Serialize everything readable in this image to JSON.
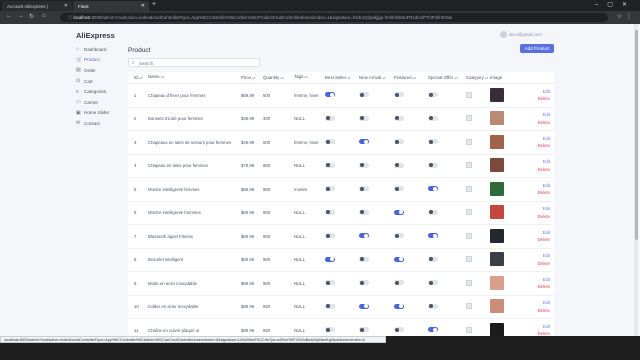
{
  "browser": {
    "tabs": [
      {
        "title": "Account AliExpress |"
      },
      {
        "title": "Flask"
      }
    ],
    "address_host": "localhost",
    "address_rest": ":8000/admin?crudAction=index&crudControllerFqcn=App%5CController%5CAdmin%5CProductCrudController&menuIndex=1&signature=h1dc1Qzpwljjgp-Xmhhhi5SuFR1dm1P7fJPmfn03nw",
    "status_url": "localhost:8000/admin?crudAction=index&crudControllerFqcn=App%5CController%5CAdmin%5CCarrCrudController&menuIndex=6&signature=U2hUMeeTKCCrfn7pw-wIEIsh%2FJGWxBudAXykfwvEgl4sub&menuIndex=6"
  },
  "app": {
    "brand": "AliExpress",
    "user_email": "alice@gmail.com",
    "page_title": "Product",
    "add_button": "Add Product",
    "search_placeholder": "Search"
  },
  "sidebar": {
    "items": [
      {
        "label": "Dashboard",
        "icon": "home-icon",
        "glyph": "⌂",
        "active": false
      },
      {
        "label": "Product",
        "icon": "shopping-cart-icon",
        "glyph": "🛒",
        "active": true
      },
      {
        "label": "Order",
        "icon": "receipt-icon",
        "glyph": "▤",
        "active": false
      },
      {
        "label": "Cart",
        "icon": "cart-icon",
        "glyph": "⊡",
        "active": false
      },
      {
        "label": "Categories",
        "icon": "list-icon",
        "glyph": "≡",
        "active": false
      },
      {
        "label": "Carrier",
        "icon": "truck-icon",
        "glyph": "▭",
        "active": false
      },
      {
        "label": "Home Slider",
        "icon": "image-icon",
        "glyph": "▣",
        "active": false
      },
      {
        "label": "Contact",
        "icon": "envelope-icon",
        "glyph": "✉",
        "active": false
      }
    ]
  },
  "table": {
    "columns": {
      "id": "ID",
      "name": "Name",
      "price": "Price",
      "quantity": "Quantity",
      "tags": "Tags",
      "best_seller": "Best Seller",
      "new_arrival": "New Arrival",
      "featured": "Featured",
      "special_offer": "Special Offer",
      "category": "Category",
      "image": "Image"
    },
    "edit_label": "Edit",
    "delete_label": "Delete",
    "rows": [
      {
        "id": "1",
        "name": "Chapeau d'hiver pour femmes",
        "price": "$69.99",
        "qty": "500",
        "tags": "femme, hiver",
        "best": true,
        "new": false,
        "feat": false,
        "spec": false,
        "img": "#3a2c3a"
      },
      {
        "id": "2",
        "name": "Bonnets tricoté pour femmes",
        "price": "$39.99",
        "qty": "300",
        "tags": "NULL",
        "best": false,
        "new": false,
        "feat": false,
        "spec": false,
        "img": "#b98b73"
      },
      {
        "id": "3",
        "name": "Chapeaux en laine de velours pour femmes",
        "price": "$49.99",
        "qty": "500",
        "tags": "femme, hiver",
        "best": false,
        "new": true,
        "feat": false,
        "spec": false,
        "img": "#a0624a"
      },
      {
        "id": "4",
        "name": "Chapeau en laine pour femmes",
        "price": "$79.99",
        "qty": "800",
        "tags": "NULL",
        "best": false,
        "new": false,
        "feat": false,
        "spec": false,
        "img": "#7a4a3c"
      },
      {
        "id": "5",
        "name": "Montre intelligente femmes",
        "price": "$89.99",
        "qty": "900",
        "tags": "montre",
        "best": false,
        "new": false,
        "feat": false,
        "spec": true,
        "img": "#2f6b3a"
      },
      {
        "id": "6",
        "name": "Montre intelligente hommes",
        "price": "$69.99",
        "qty": "800",
        "tags": "NULL",
        "best": false,
        "new": false,
        "feat": true,
        "spec": false,
        "img": "#c4473f"
      },
      {
        "id": "7",
        "name": "Bluetooth appel Fitness",
        "price": "$69.99",
        "qty": "800",
        "tags": "NULL",
        "best": false,
        "new": true,
        "feat": false,
        "spec": true,
        "img": "#222831"
      },
      {
        "id": "8",
        "name": "Bracelet intelligent",
        "price": "$69.99",
        "qty": "900",
        "tags": "NULL",
        "best": true,
        "new": false,
        "feat": true,
        "spec": false,
        "img": "#3b3f46"
      },
      {
        "id": "9",
        "name": "Mode en acier inoxydable",
        "price": "$89.99",
        "qty": "900",
        "tags": "NULL",
        "best": false,
        "new": false,
        "feat": false,
        "spec": false,
        "img": "#d8a08a"
      },
      {
        "id": "10",
        "name": "Collier en acier inoxydable",
        "price": "$89.99",
        "qty": "500",
        "tags": "NULL",
        "best": false,
        "new": true,
        "feat": true,
        "spec": false,
        "img": "#c98d7a"
      },
      {
        "id": "11",
        "name": "Chaîne en cuivre plaqué or",
        "price": "$89.99",
        "qty": "500",
        "tags": "NULL",
        "best": false,
        "new": false,
        "feat": false,
        "spec": true,
        "img": "#1b1b1b"
      }
    ]
  },
  "colors": {
    "accent": "#4a63d8",
    "danger": "#e0415d",
    "link": "#6d7cf0"
  }
}
